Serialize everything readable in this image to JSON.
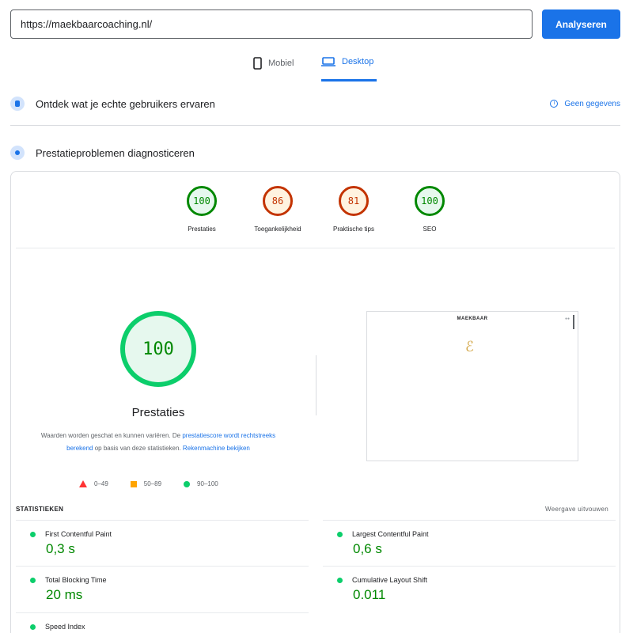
{
  "search": {
    "url": "https://maekbaarcoaching.nl/",
    "button_label": "Analyseren"
  },
  "device_tabs": [
    {
      "label": "Mobiel",
      "active": false
    },
    {
      "label": "Desktop",
      "active": true
    }
  ],
  "sections": {
    "field_data": {
      "title": "Ontdek wat je echte gebruikers ervaren",
      "no_data_label": "Geen gegevens"
    },
    "lab_data": {
      "title": "Prestatieproblemen diagnosticeren"
    }
  },
  "scores": [
    {
      "label": "Prestaties",
      "score": "100",
      "status": "good"
    },
    {
      "label": "Toegankelijkheid",
      "score": "86",
      "status": "average"
    },
    {
      "label": "Praktische tips",
      "score": "81",
      "status": "average"
    },
    {
      "label": "SEO",
      "score": "100",
      "status": "good"
    }
  ],
  "performance": {
    "score": "100",
    "label": "Prestaties",
    "description_prefix": "Waarden worden geschat en kunnen variëren. De ",
    "description_link1": "prestatiescore wordt rechtstreeks berekend",
    "description_mid": " op basis van deze statistieken. ",
    "description_link2": "Rekenmachine bekijken"
  },
  "legend": [
    {
      "range": "0–49",
      "color": "#ff3333",
      "shape": "triangle"
    },
    {
      "range": "50–89",
      "color": "#ffa400",
      "shape": "square"
    },
    {
      "range": "90–100",
      "color": "#0cce6b",
      "shape": "circle"
    }
  ],
  "screenshot": {
    "site_logo_text": "MAEKBAAR"
  },
  "statistics": {
    "heading": "STATISTIEKEN",
    "expand_label": "Weergave uitvouwen",
    "metrics": [
      {
        "name": "First Contentful Paint",
        "value": "0,3 s"
      },
      {
        "name": "Largest Contentful Paint",
        "value": "0,6 s"
      },
      {
        "name": "Total Blocking Time",
        "value": "20 ms"
      },
      {
        "name": "Cumulative Layout Shift",
        "value": "0.011"
      },
      {
        "name": "Speed Index",
        "value": ""
      }
    ]
  },
  "colors": {
    "accent": "#1a73e8",
    "good": "#0cce6b",
    "average": "#ffa400",
    "poor": "#ff3333"
  }
}
